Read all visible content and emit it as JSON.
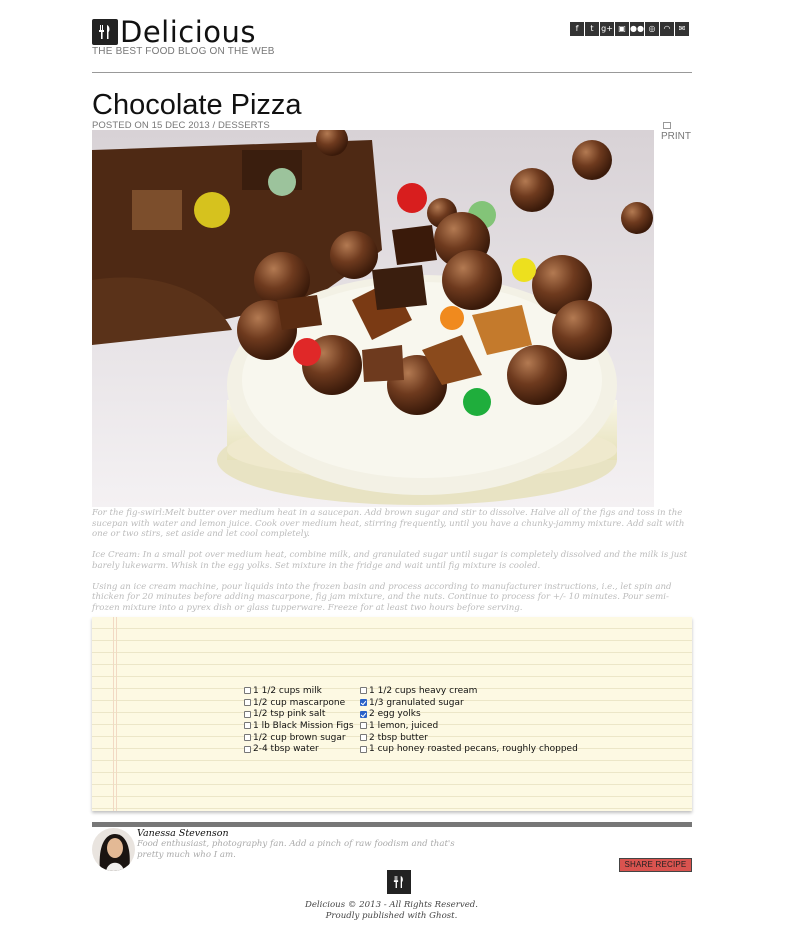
{
  "site": {
    "title": "Delicious",
    "tagline": "THE BEST FOOD BLOG ON THE WEB",
    "social_icons": [
      "facebook-icon",
      "twitter-icon",
      "google-plus-icon",
      "instagram-icon",
      "flickr-icon",
      "dribbble-icon",
      "rss-icon",
      "mail-icon"
    ],
    "social_glyphs": [
      "f",
      "t",
      "g+",
      "▣",
      "●●",
      "◎",
      "◠",
      "✉"
    ]
  },
  "post": {
    "title": "Chocolate Pizza",
    "meta": "POSTED ON 15 DEC 2013 / DESSERTS",
    "print_label": "PRINT",
    "image_alt": "chocolate pizza photo",
    "paragraphs": [
      "For the fig-swirl:Melt butter over medium heat in a saucepan. Add brown sugar and stir to dissolve. Halve all of the figs and toss in the sucepan with water and lemon juice. Cook over medium heat, stirring frequently, until you have a chunky-jammy mixture. Add salt with one or two stirs, set aside and let cool completely.",
      "Ice Cream: In a small pot over medium heat, combine milk, and granulated sugar until sugar is completely dissolved and the milk is just barely lukewarm. Whisk in the egg yolks. Set mixture in the fridge and wait until fig mixture is cooled.",
      "Using an ice cream machine, pour liquids into the frozen basin and process according to manufacturer instructions, i.e., let spin and thicken for 20 minutes before adding mascarpone, fig jam mixture, and the nuts. Continue to process for +/- 10 minutes. Pour semi-frozen mixture into a pyrex dish or glass tupperware. Freeze for at least two hours before serving."
    ]
  },
  "ingredients": {
    "left": [
      {
        "label": "1 1/2 cups milk",
        "checked": false
      },
      {
        "label": "1/2 cup mascarpone",
        "checked": false
      },
      {
        "label": "1/2 tsp pink salt",
        "checked": false
      },
      {
        "label": "1 lb Black Mission Figs",
        "checked": false
      },
      {
        "label": "1/2 cup brown sugar",
        "checked": false
      },
      {
        "label": "2-4 tbsp water",
        "checked": false
      }
    ],
    "right": [
      {
        "label": "1 1/2 cups heavy cream",
        "checked": false
      },
      {
        "label": "1/3 granulated sugar",
        "checked": true
      },
      {
        "label": "2 egg yolks",
        "checked": true
      },
      {
        "label": "1 lemon, juiced",
        "checked": false
      },
      {
        "label": "2 tbsp butter",
        "checked": false
      },
      {
        "label": "1 cup honey roasted pecans, roughly chopped",
        "checked": false
      }
    ]
  },
  "author": {
    "name": "Vanessa Stevenson",
    "bio": "Food enthusiast, photography fan. Add a pinch of raw foodism and that's pretty much who I am."
  },
  "share_label": "SHARE RECIPE",
  "footer": {
    "line1": "Delicious © 2013 - All Rights Reserved.",
    "line2": "Proudly published with Ghost."
  },
  "colors": {
    "accent": "#d9534f",
    "paper": "#fdf9e3",
    "checkbox_checked": "#2a62c8"
  }
}
